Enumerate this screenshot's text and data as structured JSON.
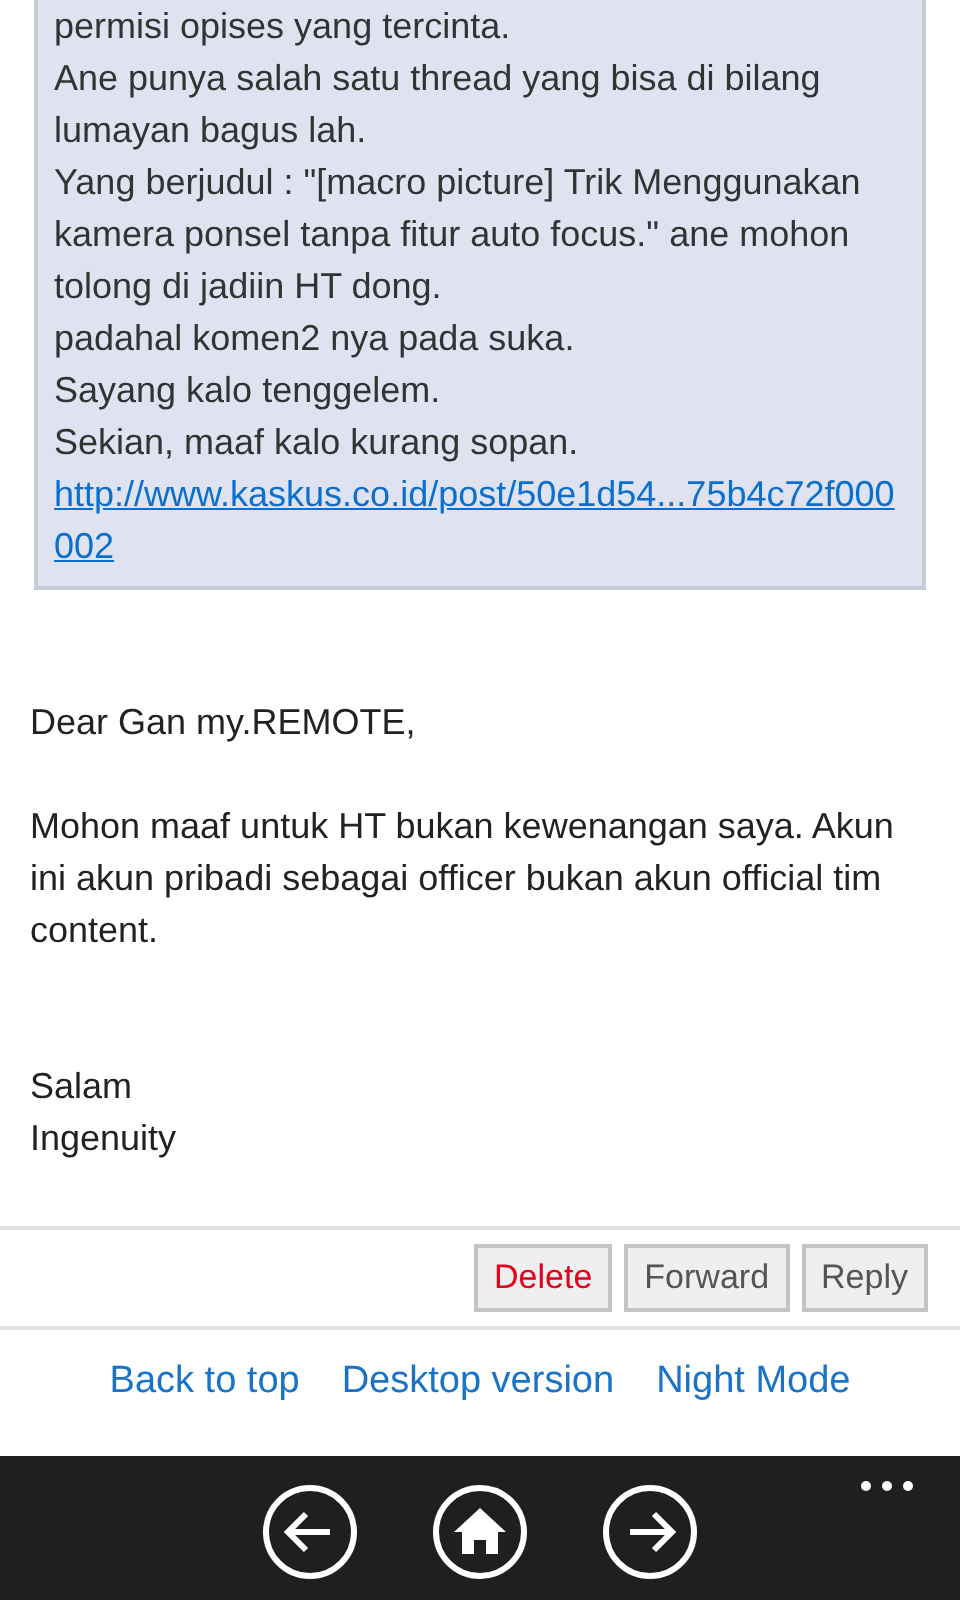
{
  "quote": {
    "lines": [
      "permisi opises yang tercinta.",
      "Ane punya salah satu thread yang bisa di bilang lumayan bagus lah.",
      "Yang berjudul : \"[macro picture] Trik Menggunakan kamera ponsel tanpa fitur auto focus.\" ane mohon tolong di jadiin HT dong.",
      "padahal komen2 nya pada suka.",
      "Sayang kalo tenggelem.",
      "Sekian, maaf kalo kurang sopan."
    ],
    "link": "http://www.kaskus.co.id/post/50e1d54...75b4c72f000002"
  },
  "reply": {
    "greeting": "Dear Gan my.REMOTE,",
    "body": "Mohon maaf untuk HT bukan kewenangan saya. Akun ini akun pribadi sebagai officer bukan akun official tim content.",
    "closing": "Salam",
    "signature": "Ingenuity"
  },
  "actions": [
    {
      "label": "Delete",
      "kind": "danger"
    },
    {
      "label": "Forward",
      "kind": "normal"
    },
    {
      "label": "Reply",
      "kind": "normal"
    }
  ],
  "footer_links": [
    "Back to top",
    "Desktop version",
    "Night Mode"
  ],
  "browser_bar": {
    "buttons": [
      {
        "kind": "back"
      },
      {
        "kind": "home"
      },
      {
        "kind": "forward"
      }
    ]
  }
}
